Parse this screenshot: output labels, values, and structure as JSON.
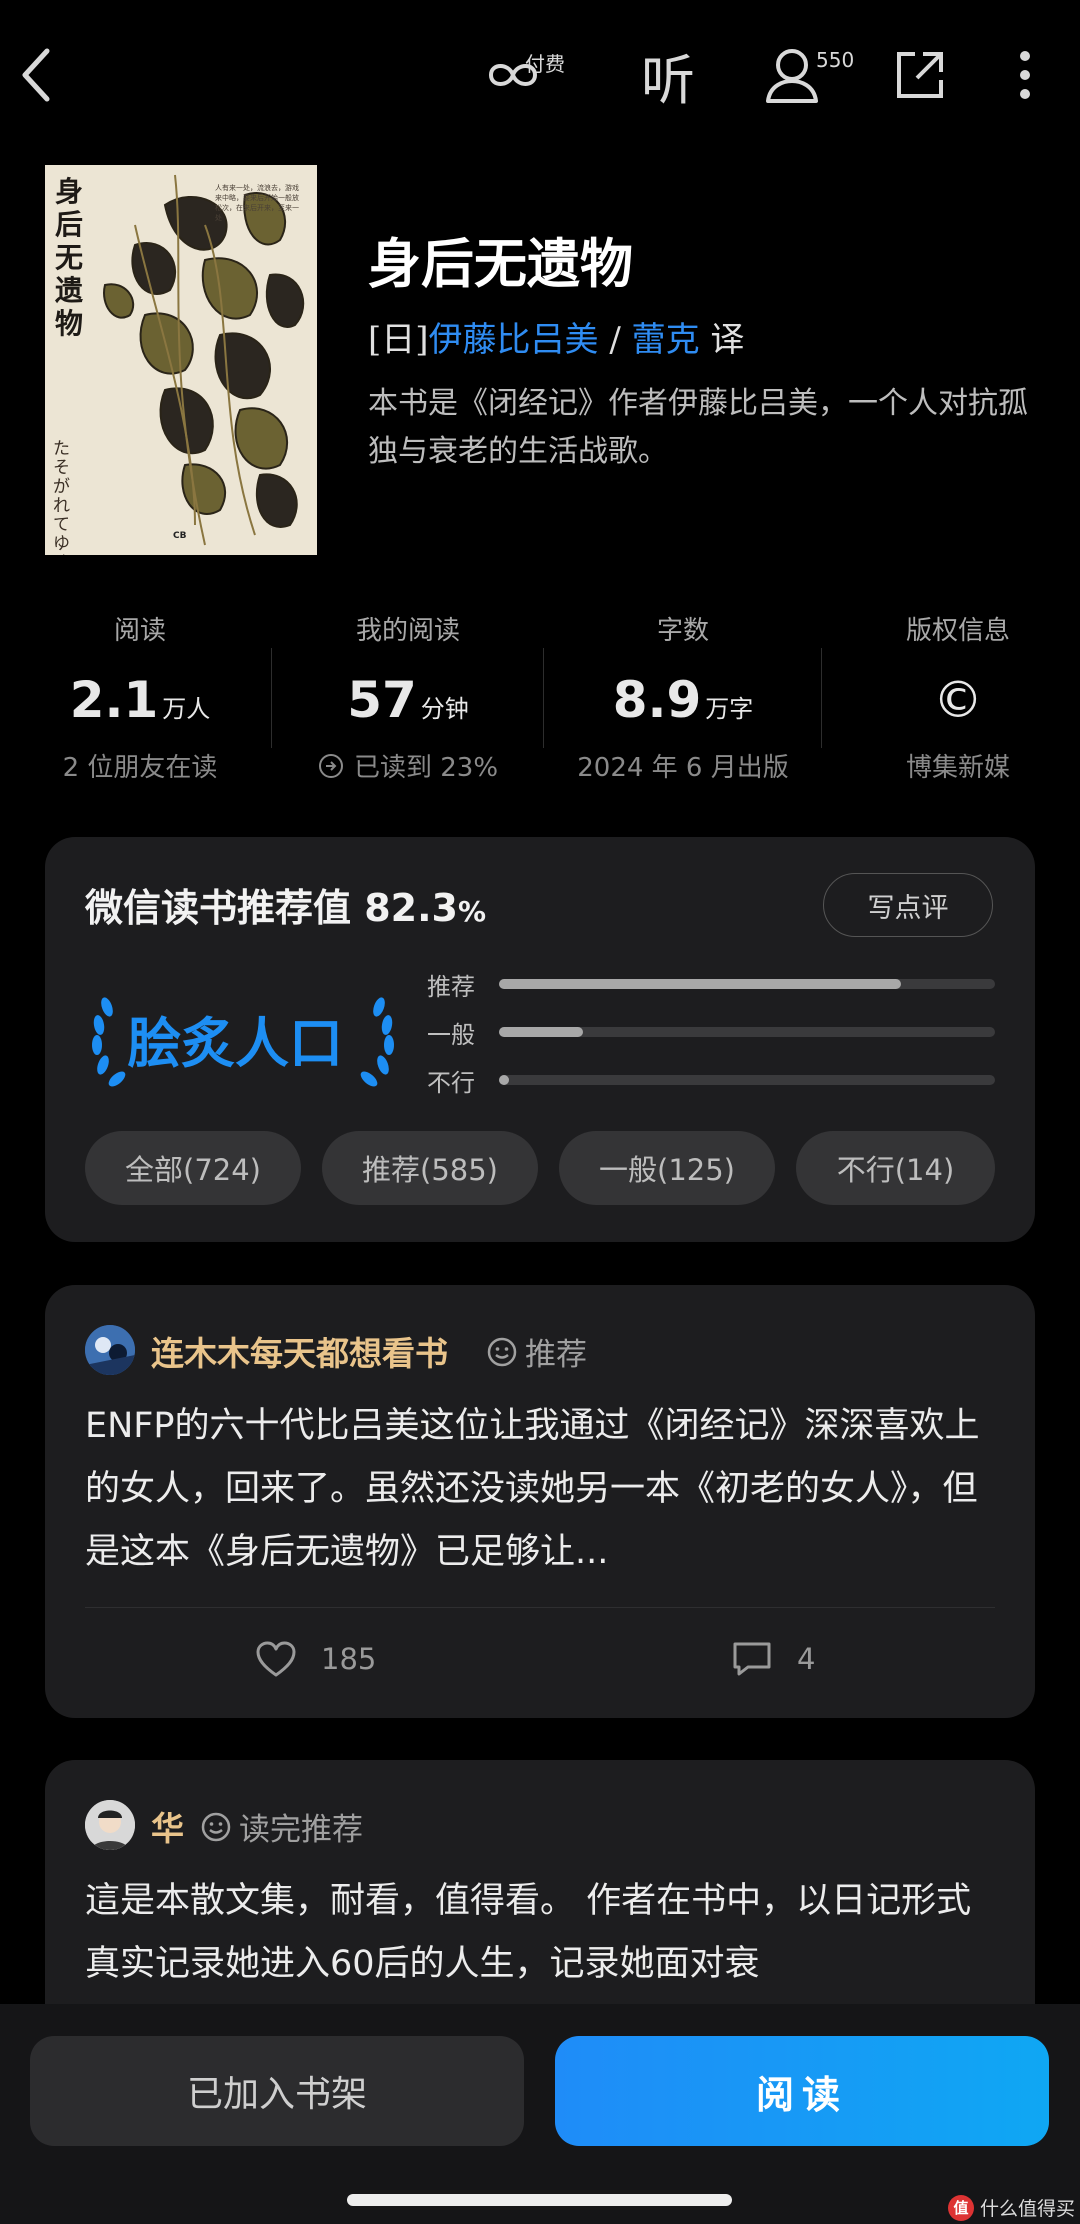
{
  "topbar": {
    "paid_label": "付费",
    "listen_label": "听",
    "followers_count": "550"
  },
  "book": {
    "cover_title": "身后无遗物",
    "cover_japanese": "たそがれてゆく子さん",
    "cover_blurb": "人有来一处，流浪去，游戏来中略，要来后开始一般放松次，在来后开来，至来一处",
    "cover_publisher_mark": "CB",
    "title": "身后无遗物",
    "author_prefix": "[日]",
    "author": "伊藤比吕美",
    "separator": " / ",
    "translator": "蕾克",
    "translator_suffix": " 译",
    "description": "本书是《闭经记》作者伊藤比吕美，一个人对抗孤独与衰老的生活战歌。"
  },
  "stats": [
    {
      "label": "阅读",
      "value": "2.1",
      "unit": "万人",
      "sub": "2 位朋友在读"
    },
    {
      "label": "我的阅读",
      "value": "57",
      "unit": "分钟",
      "sub": "已读到 23%"
    },
    {
      "label": "字数",
      "value": "8.9",
      "unit": "万字",
      "sub": "2024 年 6 月出版"
    },
    {
      "label": "版权信息",
      "value": "©",
      "unit": "",
      "sub": "博集新媒"
    }
  ],
  "rating": {
    "title": "微信读书推荐值 ",
    "value": "82.3",
    "pct_sign": "%",
    "write_button": "写点评",
    "badge": "脍炙人口",
    "bars": [
      {
        "label": "推荐",
        "fraction": 0.81
      },
      {
        "label": "一般",
        "fraction": 0.17
      },
      {
        "label": "不行",
        "fraction": 0.02
      }
    ],
    "filters": [
      "全部(724)",
      "推荐(585)",
      "一般(125)",
      "不行(14)"
    ]
  },
  "reviews": [
    {
      "user": "连木木每天都想看书",
      "tag": "推荐",
      "text": "ENFP的六十代比吕美这位让我通过《闭经记》深深喜欢上的女人，回来了。虽然还没读她另一本《初老的女人》，但是这本《身后无遗物》已足够让...",
      "likes": "185",
      "comments": "4"
    },
    {
      "user": "华",
      "tag": "读完推荐",
      "text": "這是本散文集，耐看，值得看。 作者在书中，以日记形式真实记录她进入60后的人生，记录她面对衰"
    }
  ],
  "bottom": {
    "shelf_button": "已加入书架",
    "read_button": "阅读",
    "watermark": "什么值得买",
    "watermark_logo": "值"
  }
}
